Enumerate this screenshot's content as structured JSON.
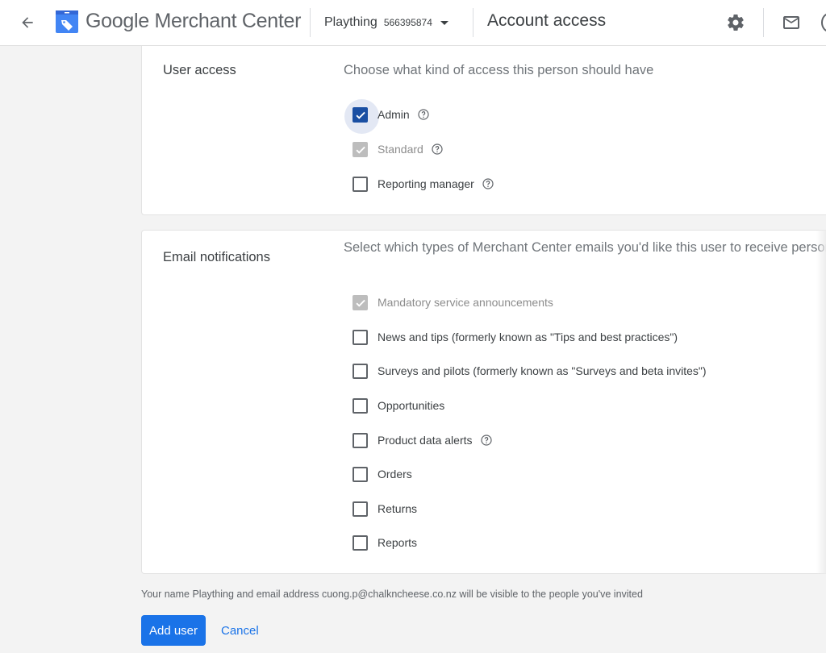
{
  "header": {
    "back_icon": "arrow-left-icon",
    "logo_icon": "merchant-center-tag-icon",
    "brand": "Google Merchant Center",
    "account_name": "Plaything",
    "account_id": "566395874",
    "page_title": "Account access",
    "settings_icon": "gear-icon",
    "mail_icon": "mail-icon",
    "colors": {
      "logo_blue": "#4285f4",
      "text": "#3c4043"
    }
  },
  "user_access": {
    "label": "User access",
    "description": "Choose what kind of access this person should have",
    "options": [
      {
        "label": "Admin",
        "checked": true,
        "disabled": false,
        "help": true
      },
      {
        "label": "Standard",
        "checked": true,
        "disabled": true,
        "help": true
      },
      {
        "label": "Reporting manager",
        "checked": false,
        "disabled": false,
        "help": true
      }
    ]
  },
  "email_notifications": {
    "label": "Email notifications",
    "description": "Select which types of Merchant Center emails you'd like this user to receive personalized",
    "options": [
      {
        "label": "Mandatory service announcements",
        "checked": true,
        "disabled": true,
        "help": false
      },
      {
        "label": "News and tips (formerly known as \"Tips and best practices\")",
        "checked": false,
        "disabled": false,
        "help": false
      },
      {
        "label": "Surveys and pilots (formerly known as \"Surveys and beta invites\")",
        "checked": false,
        "disabled": false,
        "help": false
      },
      {
        "label": "Opportunities",
        "checked": false,
        "disabled": false,
        "help": false
      },
      {
        "label": "Product data alerts",
        "checked": false,
        "disabled": false,
        "help": true
      },
      {
        "label": "Orders",
        "checked": false,
        "disabled": false,
        "help": false
      },
      {
        "label": "Returns",
        "checked": false,
        "disabled": false,
        "help": false
      },
      {
        "label": "Reports",
        "checked": false,
        "disabled": false,
        "help": false
      }
    ]
  },
  "footer": {
    "visibility_note": "Your name Plaything and email address cuong.p@chalkncheese.co.nz will be visible to the people you've invited",
    "add_user_label": "Add user",
    "cancel_label": "Cancel",
    "primary_color": "#1a73e8"
  }
}
